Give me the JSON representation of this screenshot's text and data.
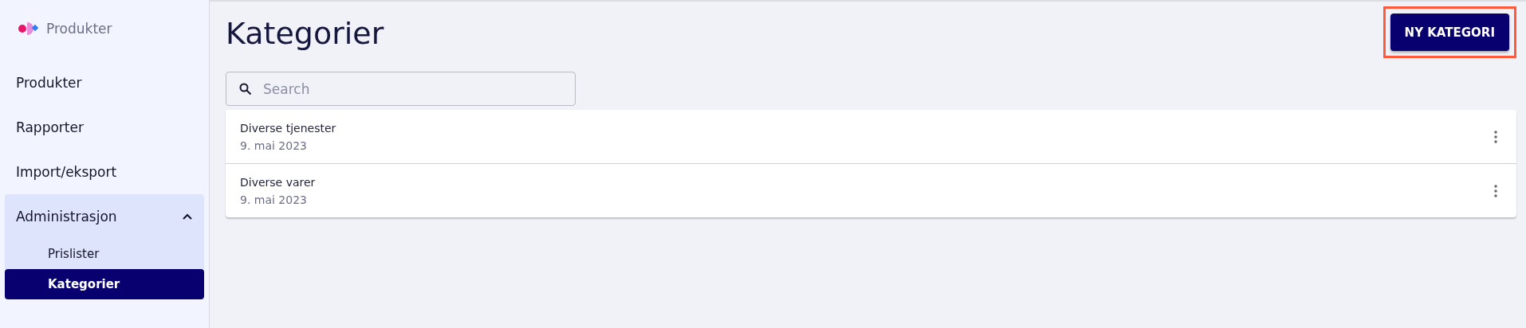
{
  "sidebar": {
    "app_name": "Produkter",
    "items": [
      {
        "label": "Produkter",
        "selected": false
      },
      {
        "label": "Rapporter",
        "selected": false
      },
      {
        "label": "Import/eksport",
        "selected": false
      },
      {
        "label": "Administrasjon",
        "selected": false,
        "expanded": true,
        "children": [
          {
            "label": "Prislister",
            "selected": false
          },
          {
            "label": "Kategorier",
            "selected": true
          }
        ]
      }
    ]
  },
  "page": {
    "title": "Kategorier",
    "new_button": {
      "label": "NY KATEGORI",
      "highlighted": true
    },
    "search": {
      "placeholder": "Search"
    },
    "list": [
      {
        "name": "Diverse tjenester",
        "date": "9. mai 2023"
      },
      {
        "name": "Diverse varer",
        "date": "9. mai 2023"
      }
    ]
  }
}
